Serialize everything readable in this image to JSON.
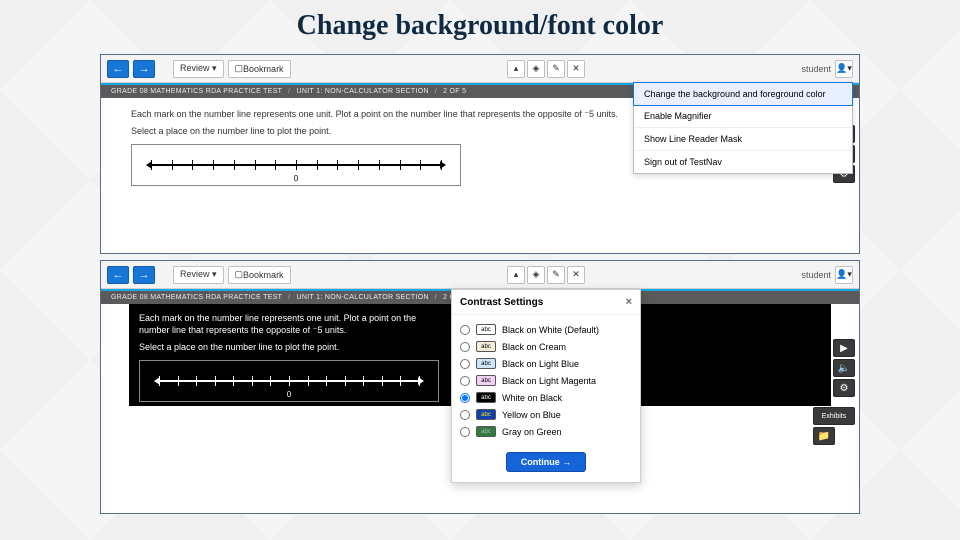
{
  "title": "Change background/font color",
  "toolbar": {
    "back": "←",
    "forward": "→",
    "review": "Review ▾",
    "bookmark": "Bookmark",
    "user": "student"
  },
  "breadcrumb": {
    "a": "GRADE 08 MATHEMATICS RDA PRACTICE TEST",
    "b": "UNIT 1: NON-CALCULATOR SECTION",
    "c": "2 OF 5"
  },
  "question": {
    "line1": "Each mark on the number line represents one unit. Plot a point on the number line that represents the opposite of ⁻5 units.",
    "line2": "Select a place on the number line to plot the point.",
    "zero": "0"
  },
  "user_menu": {
    "i1": "Change the background and foreground color",
    "i2": "Enable Magnifier",
    "i3": "Show Line Reader Mask",
    "i4": "Sign out of TestNav"
  },
  "side": {
    "play": "▶",
    "horn": "🔈",
    "gear": "⚙",
    "flag": "⚑",
    "folder": "📁"
  },
  "dialog": {
    "title": "Contrast Settings",
    "close": "×",
    "continue": "Continue →",
    "opts": [
      {
        "label": "Black on White (Default)",
        "bg": "#ffffff",
        "fg": "#000"
      },
      {
        "label": "Black on Cream",
        "bg": "#f5ecd7",
        "fg": "#000"
      },
      {
        "label": "Black on Light Blue",
        "bg": "#cfe6ff",
        "fg": "#000"
      },
      {
        "label": "Black on Light Magenta",
        "bg": "#f3d0f3",
        "fg": "#000"
      },
      {
        "label": "White on Black",
        "bg": "#000000",
        "fg": "#fff"
      },
      {
        "label": "Yellow on Blue",
        "bg": "#1040b0",
        "fg": "#ffe400"
      },
      {
        "label": "Gray on Green",
        "bg": "#2f7a3f",
        "fg": "#bdbdbd"
      }
    ]
  }
}
